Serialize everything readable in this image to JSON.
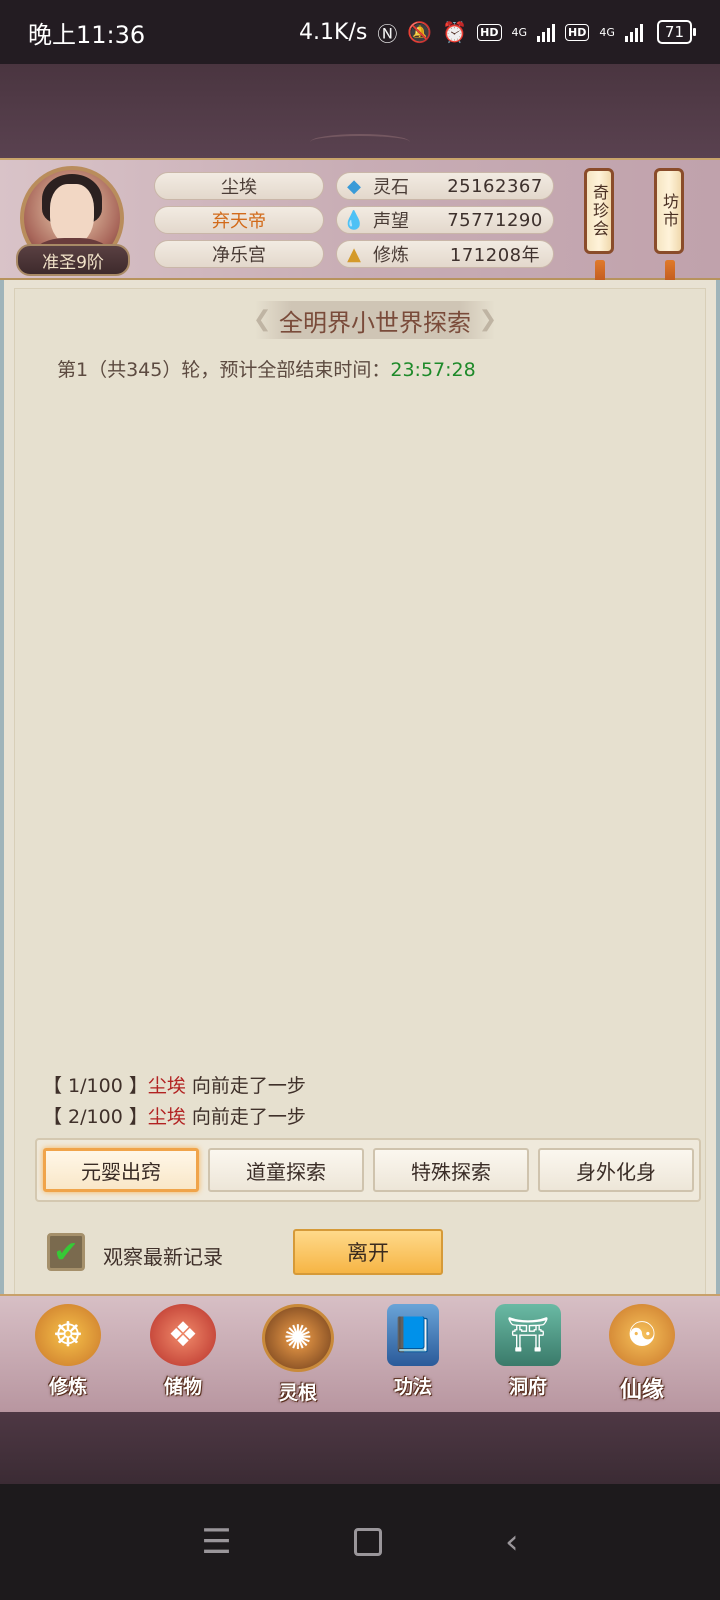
{
  "status_bar": {
    "time": "晚上11:36",
    "net_speed": "4.1K/s",
    "net1": "4G",
    "net2": "4G",
    "battery": "71"
  },
  "header": {
    "rank": "准圣9阶",
    "names": [
      "尘埃",
      "弃天帝",
      "净乐宫"
    ],
    "stats": [
      {
        "icon": "spirit-stone-icon",
        "label": "灵石",
        "value": "25162367"
      },
      {
        "icon": "reputation-icon",
        "label": "声望",
        "value": "75771290"
      },
      {
        "icon": "cultivation-icon",
        "label": "修炼",
        "value": "171208年"
      }
    ],
    "side_tabs": [
      "奇珍会",
      "坊市"
    ]
  },
  "panel": {
    "title": "全明界小世界探索",
    "round_text": "第1（共345）轮，预计全部结束时间：",
    "end_time": "23:57:28",
    "logs": [
      {
        "step": "【 1/100 】",
        "name": "尘埃",
        "action": "向前走了一步"
      },
      {
        "step": "【 2/100 】",
        "name": "尘埃",
        "action": "向前走了一步"
      }
    ],
    "actions": [
      "元婴出窍",
      "道童探索",
      "特殊探索",
      "身外化身"
    ],
    "active_action_index": 0,
    "observe_label": "观察最新记录",
    "observe_checked": true,
    "leave_label": "离开"
  },
  "bottom_nav": [
    {
      "label": "修炼",
      "icon": "meditating-monk-icon"
    },
    {
      "label": "储物",
      "icon": "treasure-bag-icon"
    },
    {
      "label": "灵根",
      "icon": "spirit-root-icon"
    },
    {
      "label": "功法",
      "icon": "scripture-book-icon"
    },
    {
      "label": "洞府",
      "icon": "cave-dwelling-icon"
    },
    {
      "label": "仙缘",
      "icon": "gourd-yinyang-icon"
    }
  ],
  "colors": {
    "accent_orange": "#d26a1a",
    "time_green": "#1e8a2a",
    "name_red": "#b22222",
    "parchment": "#e6e0cf"
  }
}
